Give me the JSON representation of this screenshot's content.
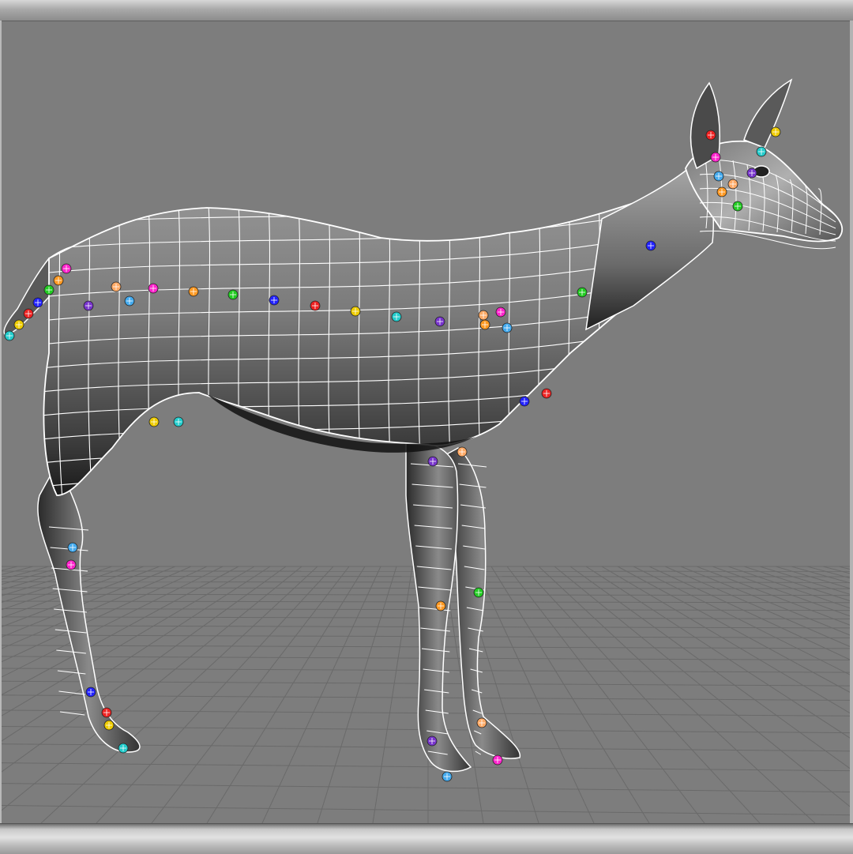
{
  "window": {
    "title": ""
  },
  "viewport": {
    "view": "perspective",
    "background_color": "#7d7d7d",
    "grid_visible": true,
    "grid_color": "#6a6a6a",
    "wireframe_on_shaded": true,
    "wire_color": "#ffffff",
    "model": "deer",
    "pivot_colors": [
      "#ff22cc",
      "#ff9922",
      "#22cc22",
      "#2222ff",
      "#ee2222",
      "#eecc00",
      "#22cccc",
      "#7733cc",
      "#ffaa66",
      "#44aaee"
    ]
  }
}
